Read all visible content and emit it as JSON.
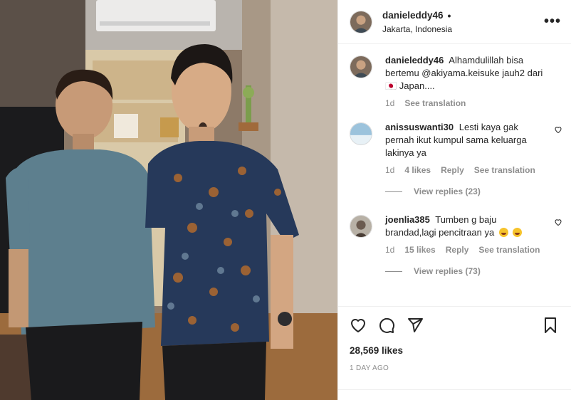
{
  "post": {
    "username": "danieleddy46",
    "dot": "•",
    "location": "Jakarta, Indonesia",
    "more": "•••"
  },
  "caption": {
    "username": "danieleddy46",
    "text": "Alhamdulillah bisa bertemu @akiyama.keisuke jauh2 dari 🇯🇵 Japan....",
    "time": "1d",
    "translate": "See translation"
  },
  "comments": [
    {
      "username": "anissuswanti30",
      "text": "Lesti kaya gak pernah ikut kumpul sama keluarga lakinya ya",
      "time": "1d",
      "likes": "4 likes",
      "reply": "Reply",
      "translate": "See translation",
      "view_replies": "View replies (23)"
    },
    {
      "username": "joenlia385",
      "text": "Tumben g baju brandad,lagi pencitraan ya",
      "time": "1d",
      "likes": "15 likes",
      "reply": "Reply",
      "translate": "See translation",
      "view_replies": "View replies (73)"
    }
  ],
  "footer": {
    "likes": "28,569 likes",
    "ago": "1 DAY AGO"
  },
  "icons": {
    "like": "heart-icon",
    "comment": "comment-icon",
    "share": "share-icon",
    "save": "bookmark-icon",
    "more": "more-icon"
  }
}
